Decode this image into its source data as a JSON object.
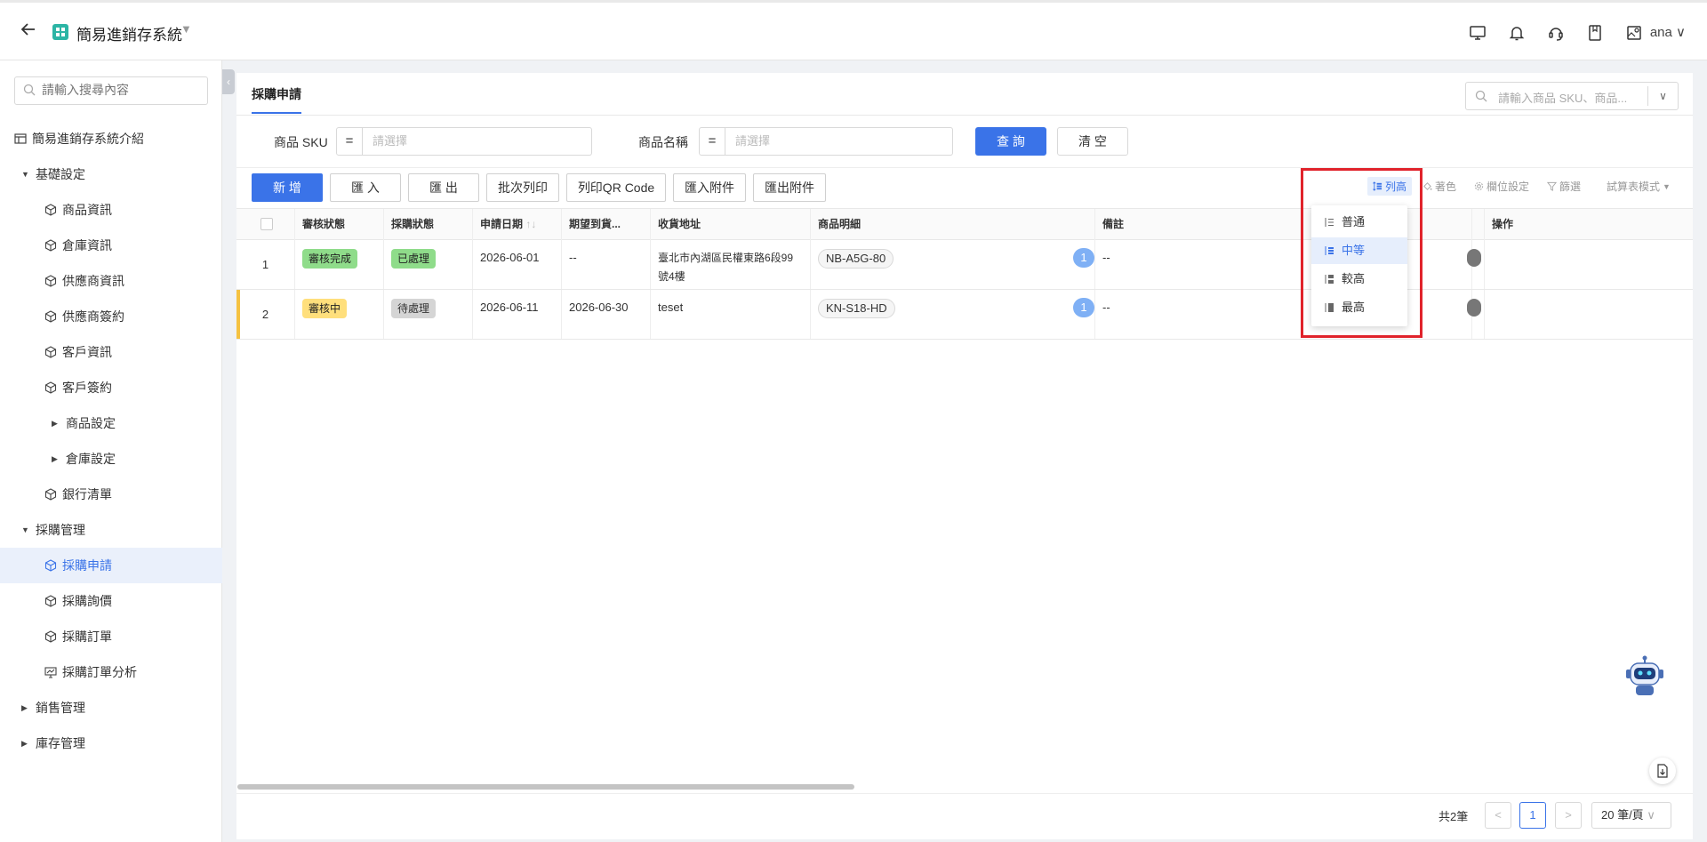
{
  "header": {
    "app_title": "簡易進銷存系統",
    "user": "ana",
    "icons": [
      "back-arrow-icon",
      "app-grid-icon",
      "monitor-icon",
      "bell-icon",
      "headset-icon",
      "book-icon",
      "image-user-icon",
      "chevron-down-icon"
    ]
  },
  "sidebar": {
    "search_placeholder": "請輸入搜尋內容",
    "items": [
      {
        "label": "簡易進銷存系統介紹",
        "icon": "table-icon"
      },
      {
        "label": "基礎設定",
        "icon": "caret-down-icon"
      },
      {
        "label": "商品資訊",
        "icon": "cube-icon"
      },
      {
        "label": "倉庫資訊",
        "icon": "cube-icon"
      },
      {
        "label": "供應商資訊",
        "icon": "cube-icon"
      },
      {
        "label": "供應商簽約",
        "icon": "cube-icon"
      },
      {
        "label": "客戶資訊",
        "icon": "cube-icon"
      },
      {
        "label": "客戶簽約",
        "icon": "cube-icon"
      },
      {
        "label": "商品設定",
        "icon": "caret-right-icon"
      },
      {
        "label": "倉庫設定",
        "icon": "caret-right-icon"
      },
      {
        "label": "銀行清單",
        "icon": "cube-icon"
      },
      {
        "label": "採購管理",
        "icon": "caret-down-icon"
      },
      {
        "label": "採購申請",
        "icon": "cube-icon",
        "active": true
      },
      {
        "label": "採購詢價",
        "icon": "cube-icon"
      },
      {
        "label": "採購訂單",
        "icon": "cube-icon"
      },
      {
        "label": "採購訂單分析",
        "icon": "chart-icon"
      },
      {
        "label": "銷售管理",
        "icon": "caret-right-icon"
      },
      {
        "label": "庫存管理",
        "icon": "caret-right-icon"
      }
    ]
  },
  "main": {
    "tab": "採購申請",
    "global_search_placeholder": "請輸入商品 SKU、商品...",
    "filters": {
      "sku_label": "商品 SKU",
      "sku_op": "=",
      "sku_placeholder": "請選擇",
      "name_label": "商品名稱",
      "name_op": "=",
      "name_placeholder": "請選擇",
      "query_button": "查 詢",
      "clear_button": "清 空"
    },
    "toolbar": {
      "add": "新 增",
      "import": "匯 入",
      "export": "匯 出",
      "batch_print": "批次列印",
      "print_qr": "列印QR Code",
      "import_attach": "匯入附件",
      "export_attach": "匯出附件",
      "row_height": "列高",
      "color": "著色",
      "column_settings": "欄位設定",
      "filter": "篩選",
      "spreadsheet_mode": "試算表模式"
    },
    "table": {
      "headers": [
        "審核狀態",
        "採購狀態",
        "申請日期",
        "期望到貨...",
        "收貨地址",
        "商品明細",
        "備註",
        "",
        "操作"
      ],
      "rows": [
        {
          "index": "1",
          "audit": "審核完成",
          "purchase": "已處理",
          "apply_date": "2026-06-01",
          "expected": "--",
          "address": "臺北市內湖區民權東路6段99號4樓",
          "sku": "NB-A5G-80",
          "count": "1",
          "note": "--"
        },
        {
          "index": "2",
          "audit": "審核中",
          "purchase": "待處理",
          "apply_date": "2026-06-11",
          "expected": "2026-06-30",
          "address": "teset",
          "sku": "KN-S18-HD",
          "count": "1",
          "note": "--"
        }
      ]
    },
    "row_height_menu": {
      "options": [
        "普通",
        "中等",
        "較高",
        "最高"
      ],
      "selected": "中等"
    },
    "pagination": {
      "total": "共2筆",
      "prev": "<",
      "page": "1",
      "next": ">",
      "page_size": "20 筆/頁"
    }
  },
  "colors": {
    "primary": "#3a73e8",
    "highlight_border": "#e0232b",
    "tag_green": "#8fdc8a",
    "tag_yellow": "#ffdf7c",
    "tag_gray": "#d5d5d5"
  }
}
